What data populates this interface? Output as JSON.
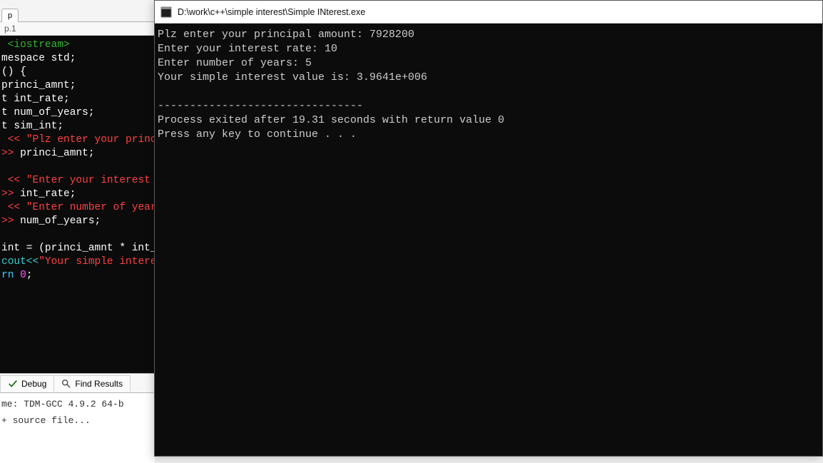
{
  "ide": {
    "tab_label": "p",
    "line_indicator": "p.1",
    "code": {
      "line1_preproc": " <iostream>",
      "line2_ns": "mespace std;",
      "line3": "() {",
      "line4": "princi_amnt;",
      "line5": "t int_rate;",
      "line6": "t num_of_years;",
      "line7": "t sim_int;",
      "line8_op": " << ",
      "line8_str": "\"Plz enter your princ",
      "line9_op": ">> ",
      "line9_id": "princi_amnt;",
      "line11_op": " << ",
      "line11_str": "\"Enter your interest ",
      "line12_op": ">> ",
      "line12_id": "int_rate;",
      "line13_op": " << ",
      "line13_str": "\"Enter number of year",
      "line14_op": ">> ",
      "line14_id": "num_of_years;",
      "line16": "int = (princi_amnt * int_",
      "line17_a": "cout<<",
      "line17_str": "\"Your simple intere",
      "line18_kw": "rn ",
      "line18_num": "0",
      "line18_end": ";"
    },
    "bottom_tabs": {
      "debug": "Debug",
      "find": "Find Results"
    },
    "status_line1": "me: TDM-GCC 4.9.2 64-b",
    "status_line2": "+ source file..."
  },
  "console": {
    "title": "D:\\work\\c++\\simple interest\\Simple INterest.exe",
    "lines": [
      "Plz enter your principal amount: 7928200",
      "Enter your interest rate: 10",
      "Enter number of years: 5",
      "Your simple interest value is: 3.9641e+006",
      "",
      "--------------------------------",
      "Process exited after 19.31 seconds with return value 0",
      "Press any key to continue . . ."
    ]
  }
}
